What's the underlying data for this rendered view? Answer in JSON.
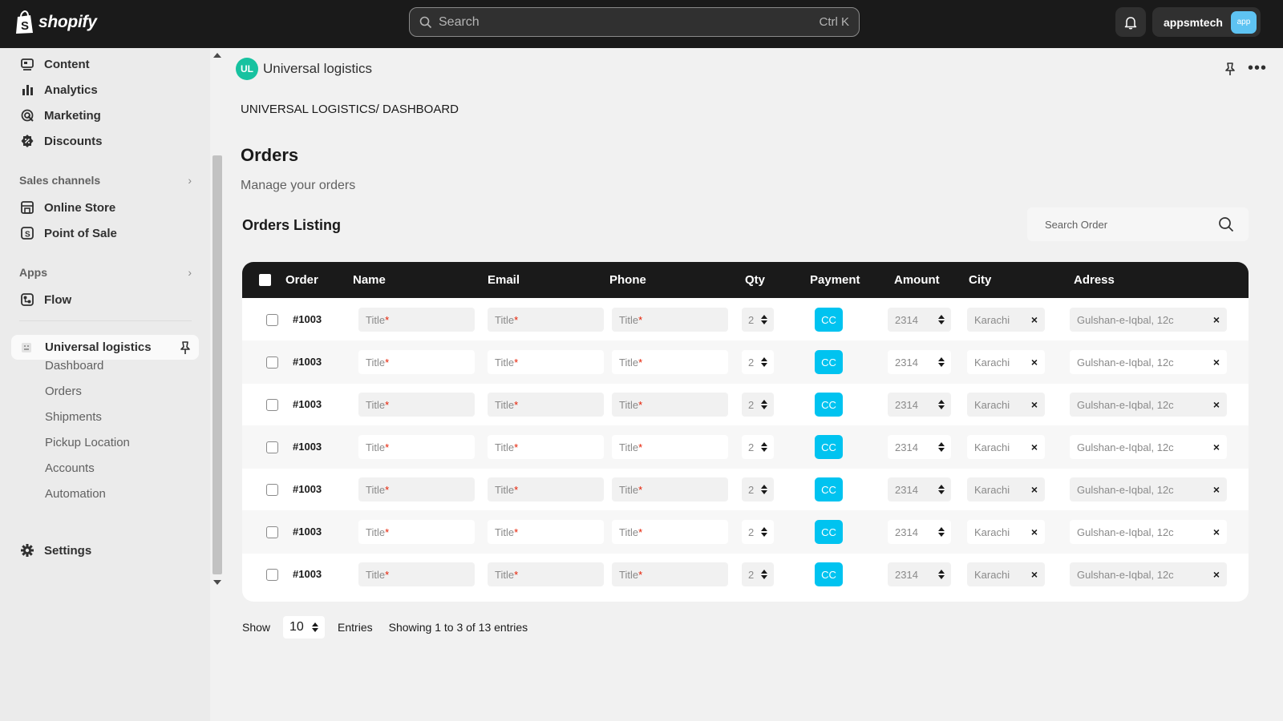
{
  "topbar": {
    "brand": "shopify",
    "search_placeholder": "Search",
    "search_shortcut": "Ctrl K",
    "account_name": "appsmtech",
    "account_badge": "app"
  },
  "sidebar": {
    "items": [
      {
        "label": "Content",
        "icon": "content-icon"
      },
      {
        "label": "Analytics",
        "icon": "analytics-icon"
      },
      {
        "label": "Marketing",
        "icon": "marketing-icon"
      },
      {
        "label": "Discounts",
        "icon": "discount-icon"
      }
    ],
    "sales_channels": {
      "title": "Sales channels",
      "items": [
        {
          "label": "Online Store",
          "icon": "store-icon"
        },
        {
          "label": "Point of Sale",
          "icon": "pos-icon"
        }
      ]
    },
    "apps": {
      "title": "Apps",
      "items": [
        {
          "label": "Flow",
          "icon": "flow-icon"
        }
      ]
    },
    "active_app": {
      "label": "Universal logistics",
      "sub_items": [
        "Dashboard",
        "Orders",
        "Shipments",
        "Pickup Location",
        "Accounts",
        "Automation"
      ]
    },
    "settings_label": "Settings"
  },
  "main": {
    "app_avatar": "UL",
    "app_title": "Universal logistics",
    "breadcrumb": "UNIVERSAL LOGISTICS/ DASHBOARD",
    "page_title": "Orders",
    "page_subtitle": "Manage your orders",
    "listing_title": "Orders Listing",
    "search_order_placeholder": "Search Order",
    "table": {
      "headers": [
        "Order",
        "Name",
        "Email",
        "Phone",
        "Qty",
        "Payment",
        "Amount",
        "City",
        "Adress"
      ],
      "rows": [
        {
          "order": "#1003",
          "name": "Title",
          "email": "Title",
          "phone": "Title",
          "qty": "2",
          "payment": "CC",
          "amount": "2314",
          "city": "Karachi",
          "address": "Gulshan-e-Iqbal, 12c"
        },
        {
          "order": "#1003",
          "name": "Title",
          "email": "Title",
          "phone": "Title",
          "qty": "2",
          "payment": "CC",
          "amount": "2314",
          "city": "Karachi",
          "address": "Gulshan-e-Iqbal, 12c"
        },
        {
          "order": "#1003",
          "name": "Title",
          "email": "Title",
          "phone": "Title",
          "qty": "2",
          "payment": "CC",
          "amount": "2314",
          "city": "Karachi",
          "address": "Gulshan-e-Iqbal, 12c"
        },
        {
          "order": "#1003",
          "name": "Title",
          "email": "Title",
          "phone": "Title",
          "qty": "2",
          "payment": "CC",
          "amount": "2314",
          "city": "Karachi",
          "address": "Gulshan-e-Iqbal, 12c"
        },
        {
          "order": "#1003",
          "name": "Title",
          "email": "Title",
          "phone": "Title",
          "qty": "2",
          "payment": "CC",
          "amount": "2314",
          "city": "Karachi",
          "address": "Gulshan-e-Iqbal, 12c"
        },
        {
          "order": "#1003",
          "name": "Title",
          "email": "Title",
          "phone": "Title",
          "qty": "2",
          "payment": "CC",
          "amount": "2314",
          "city": "Karachi",
          "address": "Gulshan-e-Iqbal, 12c"
        },
        {
          "order": "#1003",
          "name": "Title",
          "email": "Title",
          "phone": "Title",
          "qty": "2",
          "payment": "CC",
          "amount": "2314",
          "city": "Karachi",
          "address": "Gulshan-e-Iqbal, 12c"
        }
      ],
      "required_mark": "*"
    },
    "footer": {
      "show_label": "Show",
      "page_size": "10",
      "entries_label": "Entries",
      "showing_text": "Showing 1 to 3 of 13 entries"
    }
  },
  "colors": {
    "topbar_bg": "#1a1a1a",
    "payment_badge": "#00c3f0",
    "app_avatar": "#17c2a0",
    "required": "#e51c00"
  }
}
